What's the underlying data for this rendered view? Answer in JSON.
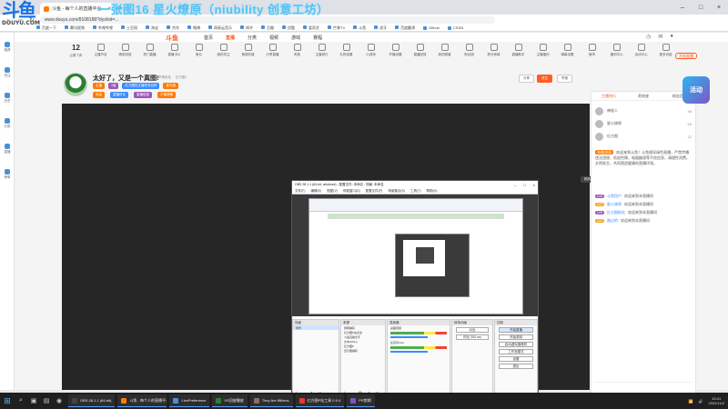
{
  "overlay": {
    "watermark_big": "斗鱼",
    "watermark_small": "DOUYU.COM",
    "stream_title": "一张图16 星火燎原（niubility 创意工坊）"
  },
  "browser": {
    "tab_title": "斗鱼 - 每个人的直播平台",
    "url": "www.douyu.com/8108188?dyshid=...",
    "bookmarks": [
      "百度一下",
      "腾讯视频",
      "哔哩哔哩",
      "土豆网",
      "淘宝",
      "京东",
      "微博",
      "网易云音乐",
      "知乎",
      "豆瓣",
      "优酷",
      "爱奇艺",
      "芒果TV",
      "斗鱼",
      "虎牙",
      "百度翻译",
      "Github",
      "CSDN"
    ]
  },
  "sidebar": {
    "items": [
      "推荐",
      "关注",
      "历史",
      "分类",
      "直播",
      "榜单"
    ]
  },
  "header": {
    "logo": "斗鱼",
    "nav": [
      "首页",
      "直播",
      "分类",
      "视频",
      "游戏",
      "赛程"
    ],
    "start_live": "开始直播"
  },
  "categories": {
    "count": "12",
    "count_label": "云霄飞车",
    "items": [
      "主播节目",
      "精彩回放",
      "热门直播",
      "直播卡片",
      "鱼丸",
      "我的关注",
      "鱼翅充值",
      "分享直播",
      "贵族",
      "主播排行",
      "礼物设置",
      "小游戏",
      "开播设置",
      "直播回放",
      "我的频道",
      "粉丝团",
      "积分商城",
      "直播助手",
      "主播福利",
      "弹幕设置",
      "鱼吧",
      "福利中心",
      "活动中心",
      "更多功能"
    ]
  },
  "room": {
    "title": "太好了，又是一个真图!",
    "meta": [
      "举报",
      "举报优化",
      "红方图+"
    ],
    "badges": [
      "主播",
      "2级",
      "红方图的主播任务名称",
      "星光值"
    ],
    "badges2": [
      "消息",
      "直播时长",
      "直播信息",
      "开播提醒"
    ],
    "share": "分享",
    "follow": "关注",
    "report": "举报"
  },
  "obs": {
    "title": "OBS 28.1.1 (64-bit, windows) - 配置文件: 未命名 - 场景: 未命名",
    "menu": [
      "文件(F)",
      "编辑(E)",
      "视图(V)",
      "停靠窗口(D)",
      "配置文件(P)",
      "场景集合(S)",
      "工具(T)",
      "帮助(H)"
    ],
    "scenes_header": "场景",
    "scene_items": [
      "场景"
    ],
    "sources_header": "来源",
    "sources": [
      "屏幕捕获",
      "红方图P站点击",
      "斗鱼直播文字",
      "文本(GDI+)",
      "红方图P",
      "显示器捕获"
    ],
    "mixer_header": "混音器",
    "mixer_tracks": [
      "桌面音频",
      "麦克风/Aux"
    ],
    "transition_header": "转场动画",
    "transition": "淡出",
    "duration": "时长 300 ms",
    "controls_header": "控制",
    "controls": [
      "开始直播",
      "开始录制",
      "启动虚拟摄像机",
      "工作室模式",
      "设置",
      "退出"
    ],
    "status": [
      "LIVE: 00:00:00",
      "REC: 00:00:00",
      "CPU: 0.4%, 60.00 fps"
    ]
  },
  "player": {
    "fullscreen": "网页全屏"
  },
  "chat": {
    "tabs": [
      "主播排行",
      "贵宾座",
      "粉丝团"
    ],
    "rank": [
      {
        "name": "神秘人",
        "value": "88"
      },
      {
        "name": "星火燎原",
        "value": "56"
      },
      {
        "name": "红方图",
        "value": "32"
      }
    ],
    "announcement_tag": "系统消息",
    "announcement": "欢迎来到斗鱼！斗鱼倡导绿色直播，严禁传播违法违规、低俗色情、吸烟酗酒等不良信息，请理性消费，文明发言，共同营造健康的直播环境。",
    "messages": [
      {
        "level": "LV6",
        "name": "斗鱼用户",
        "text": "欢迎来到本直播间"
      },
      {
        "level": "LV3",
        "name": "星火燎原",
        "text": "欢迎来到本直播间"
      },
      {
        "level": "LV5",
        "name": "红方图粉丝",
        "text": "欢迎来到本直播间"
      },
      {
        "level": "LV1",
        "name": "路过的",
        "text": "欢迎来到本直播间"
      }
    ],
    "promo": "活动"
  },
  "taskbar": {
    "tasks": [
      "OBS 28.1.1 (64-bit)",
      "斗鱼 - 每个人的直播平台",
      "LivePreference",
      "VS回放播放",
      "They Are Billions",
      "红方图P站工具 0.9.4",
      "PR剪辑"
    ],
    "time": "10:41",
    "date": "2022/11/2"
  },
  "colors": {
    "brand": "#ff5d23",
    "overlay_title": "#4fc3f7",
    "taskbar": "#1f1f1f"
  }
}
